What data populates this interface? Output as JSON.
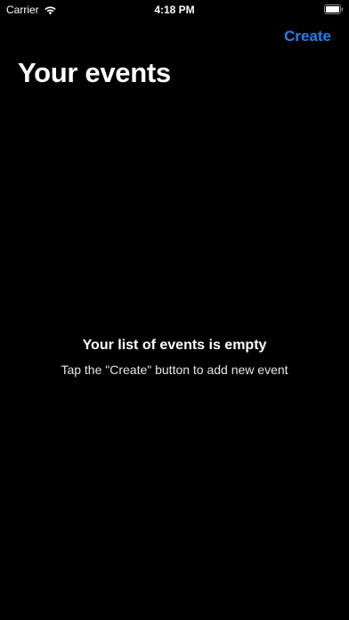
{
  "status_bar": {
    "carrier": "Carrier",
    "time": "4:18 PM"
  },
  "nav": {
    "create_label": "Create",
    "title": "Your events"
  },
  "empty_state": {
    "title": "Your list of events is empty",
    "subtitle": "Tap the \"Create\" button to add new event"
  },
  "colors": {
    "background": "#000000",
    "accent": "#1e82f0",
    "text": "#ffffff"
  },
  "icons": [
    "wifi-icon",
    "battery-icon"
  ]
}
